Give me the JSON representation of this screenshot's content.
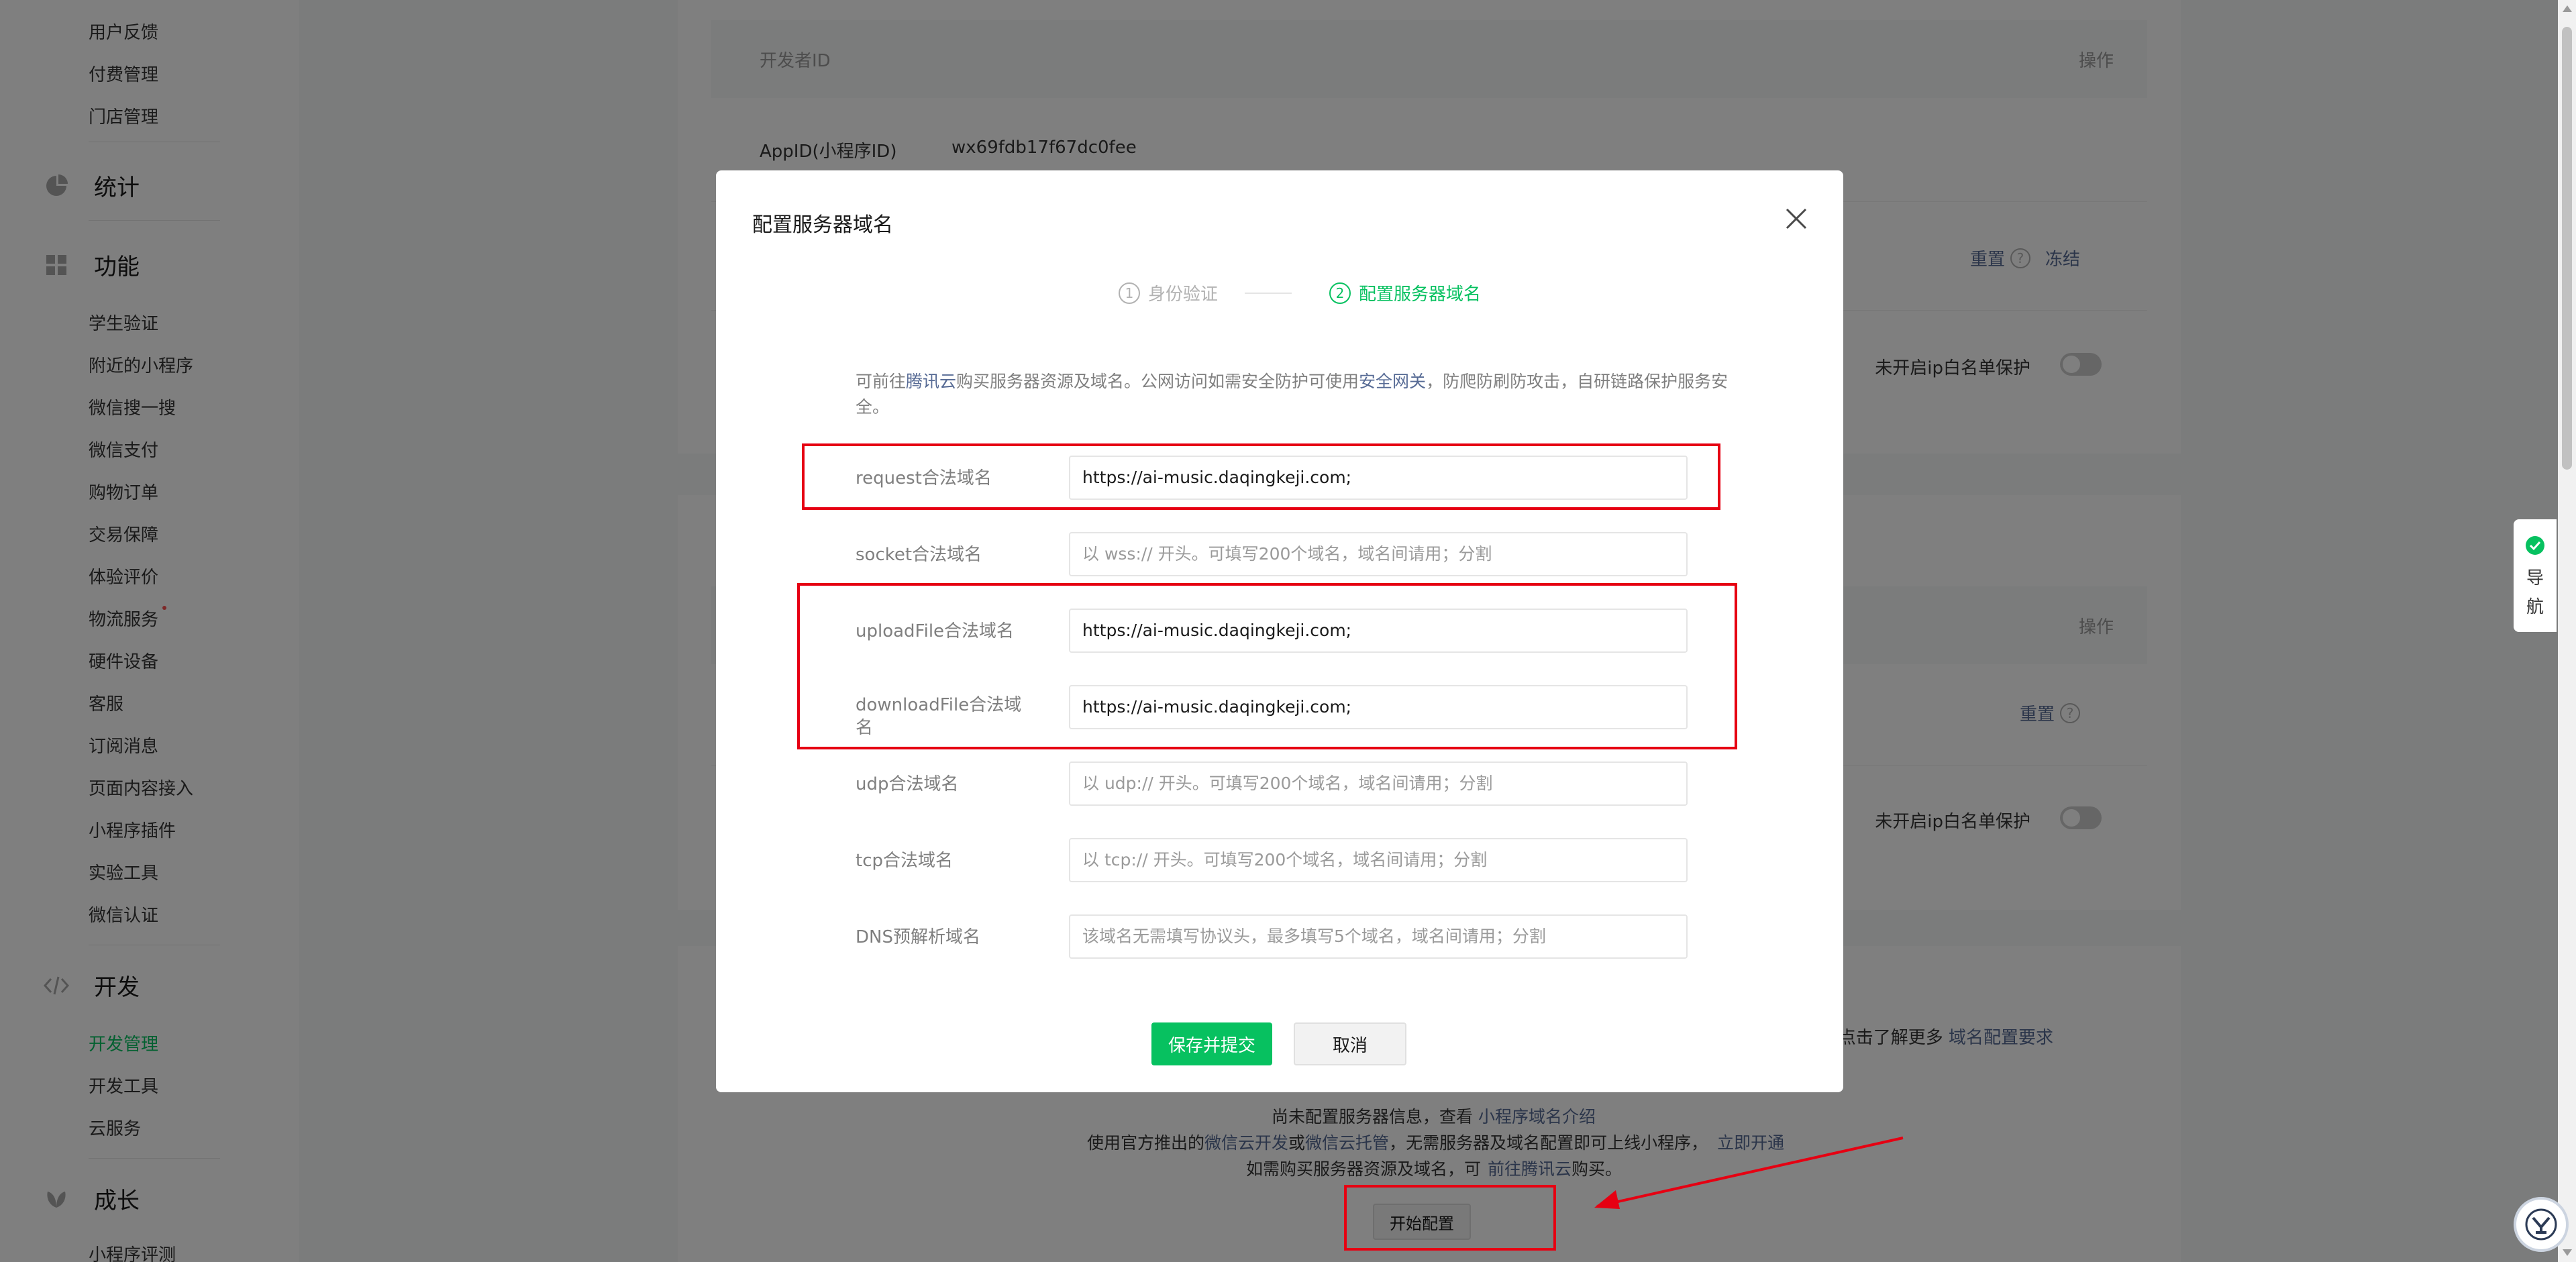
{
  "sidebar": {
    "top_items": [
      "用户反馈",
      "付费管理",
      "门店管理"
    ],
    "groups": {
      "stats": {
        "label": "统计",
        "icon": "pie-chart-icon"
      },
      "features": {
        "label": "功能",
        "icon": "grid-icon",
        "items": [
          "学生验证",
          "附近的小程序",
          "微信搜一搜",
          "微信支付",
          "购物订单",
          "交易保障",
          "体验评价",
          "物流服务",
          "硬件设备",
          "客服",
          "订阅消息",
          "页面内容接入",
          "小程序插件",
          "实验工具",
          "微信认证"
        ]
      },
      "dev": {
        "label": "开发",
        "icon": "code-icon",
        "items": [
          "开发管理",
          "开发工具",
          "云服务"
        ],
        "active": "开发管理"
      },
      "growth": {
        "label": "成长",
        "icon": "leaf-icon",
        "items": [
          "小程序评测"
        ]
      }
    }
  },
  "main": {
    "card1": {
      "col_dev_id": "开发者ID",
      "col_action": "操作",
      "appid_label": "AppID(小程序ID)",
      "appid_value": "wx69fdb17f67dc0fee",
      "reset_label": "重置",
      "freeze_label": "冻结",
      "ip_whitelist_label": "未开启ip白名单保护"
    },
    "card2": {
      "col_action": "操作",
      "reset_label": "重置",
      "ip_whitelist_label": "未开启ip白名单保护"
    },
    "card3": {
      "domain_req_text": "点击了解更多",
      "domain_req_link": "域名配置要求",
      "line1_text": "尚未配置服务器信息，查看",
      "line1_link": "小程序域名介绍",
      "line2_a": "使用官方推出的",
      "line2_link1": "微信云开发",
      "line2_b": "或",
      "line2_link2": "微信云托管",
      "line2_c": "，无需服务器及域名配置即可上线小程序，",
      "line2_link3": "立即开通",
      "line3_text": "如需购买服务器资源及域名，可",
      "line3_link": "前往腾讯云",
      "line3_tail": "购买。",
      "start_config_label": "开始配置"
    }
  },
  "modal": {
    "title": "配置服务器域名",
    "steps": [
      {
        "num": "1",
        "label": "身份验证",
        "active": false
      },
      {
        "num": "2",
        "label": "配置服务器域名",
        "active": true
      }
    ],
    "tip": {
      "part1": "可前往",
      "link1": "腾讯云",
      "part2": "购买服务器资源及域名。公网访问如需安全防护可使用",
      "link2": "安全网关",
      "part3": "，防爬防刷防攻击，自研链路保护服务安全。"
    },
    "rows": [
      {
        "label": "request合法域名",
        "value": "https://ai-music.daqingkeji.com;",
        "placeholder": ""
      },
      {
        "label": "socket合法域名",
        "value": "",
        "placeholder": "以 wss:// 开头。可填写200个域名，域名间请用；分割"
      },
      {
        "label": "uploadFile合法域名",
        "value": "https://ai-music.daqingkeji.com;",
        "placeholder": ""
      },
      {
        "label": "downloadFile合法域名",
        "value": "https://ai-music.daqingkeji.com;",
        "placeholder": ""
      },
      {
        "label": "udp合法域名",
        "value": "",
        "placeholder": "以 udp:// 开头。可填写200个域名，域名间请用；分割"
      },
      {
        "label": "tcp合法域名",
        "value": "",
        "placeholder": "以 tcp:// 开头。可填写200个域名，域名间请用；分割"
      },
      {
        "label": "DNS预解析域名",
        "value": "",
        "placeholder": "该域名无需填写协议头，最多填写5个域名，域名间请用；分割"
      }
    ],
    "save_label": "保存并提交",
    "cancel_label": "取消"
  },
  "right_widget": {
    "nav_label_1": "导",
    "nav_label_2": "航"
  },
  "colors": {
    "primary": "#07c160",
    "link": "#576b95",
    "annotation": "#e60012"
  }
}
